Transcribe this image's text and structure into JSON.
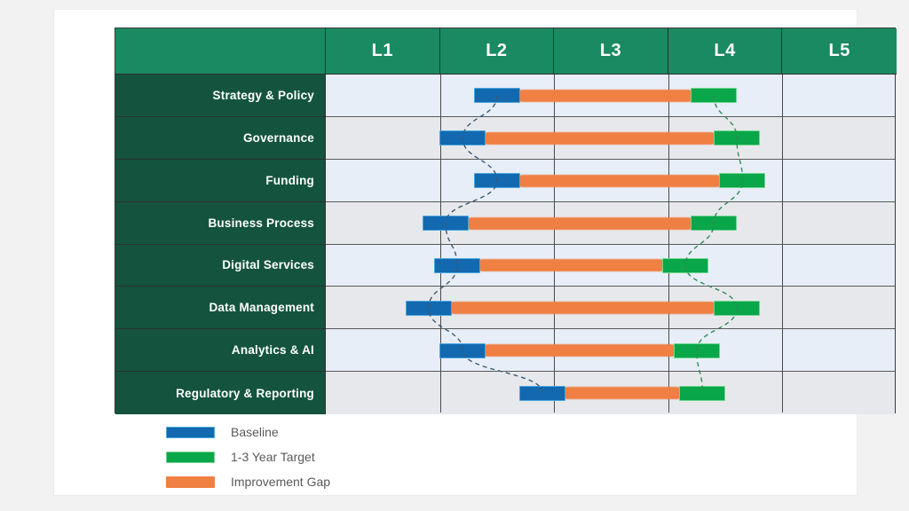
{
  "chart_data": {
    "type": "bar",
    "title": "",
    "xlabel": "",
    "ylabel": "",
    "legend_position": "bottom-left",
    "grid": true,
    "levels": [
      "L1",
      "L2",
      "L3",
      "L4",
      "L5"
    ],
    "level_axis": [
      1,
      2,
      3,
      4,
      5
    ],
    "categories": [
      "Strategy & Policy",
      "Governance",
      "Funding",
      "Business Process",
      "Digital Services",
      "Data Management",
      "Analytics & AI",
      "Regulatory & Reporting"
    ],
    "series": [
      {
        "name": "Baseline",
        "color": "#1369b0",
        "values": [
          2.0,
          1.7,
          2.0,
          1.55,
          1.65,
          1.4,
          1.7,
          2.4
        ]
      },
      {
        "name": "1-3 Year Target",
        "color": "#0aa64a",
        "values": [
          3.9,
          4.1,
          4.15,
          3.9,
          3.65,
          4.1,
          3.75,
          3.8
        ]
      },
      {
        "name": "Improvement Gap",
        "color": "#ef7f43",
        "values": [
          1.9,
          2.4,
          2.15,
          2.35,
          2.0,
          2.7,
          2.05,
          1.4
        ]
      }
    ],
    "rows": [
      {
        "category": "Strategy & Policy",
        "baseline": 2.0,
        "target": 3.9,
        "gap": 1.9
      },
      {
        "category": "Governance",
        "baseline": 1.7,
        "target": 4.1,
        "gap": 2.4
      },
      {
        "category": "Funding",
        "baseline": 2.0,
        "target": 4.15,
        "gap": 2.15
      },
      {
        "category": "Business Process",
        "baseline": 1.55,
        "target": 3.9,
        "gap": 2.35
      },
      {
        "category": "Digital Services",
        "baseline": 1.65,
        "target": 3.65,
        "gap": 2.0
      },
      {
        "category": "Data Management",
        "baseline": 1.4,
        "target": 4.1,
        "gap": 2.7
      },
      {
        "category": "Analytics & AI",
        "baseline": 1.7,
        "target": 3.75,
        "gap": 2.05
      },
      {
        "category": "Regulatory & Reporting",
        "baseline": 2.4,
        "target": 3.8,
        "gap": 1.4
      }
    ]
  },
  "table": {
    "corner_label": "",
    "column_headers": [
      "L1",
      "L2",
      "L3",
      "L4",
      "L5"
    ],
    "row_headers": [
      "Strategy & Policy",
      "Governance",
      "Funding",
      "Business Process",
      "Digital Services",
      "Data Management",
      "Analytics & AI",
      "Regulatory & Reporting"
    ]
  },
  "legend": {
    "items": [
      {
        "label": "Baseline",
        "color": "#1369b0",
        "swatch": "baseline"
      },
      {
        "label": "1-3 Year Target",
        "color": "#0aa64a",
        "swatch": "target"
      },
      {
        "label": "Improvement Gap",
        "color": "#ef7f43",
        "swatch": "gap"
      }
    ]
  },
  "colors": {
    "header_green": "#1a8a63",
    "rowlabel_green": "#14543f",
    "row_odd": "#e7eef7",
    "row_even": "#e7e8ec",
    "page_background": "#f2f2f2",
    "card_background": "#ffffff",
    "grid_line": "#4a4a4a",
    "baseline_connector": "#3c5a72",
    "target_connector": "#2e8b57"
  }
}
